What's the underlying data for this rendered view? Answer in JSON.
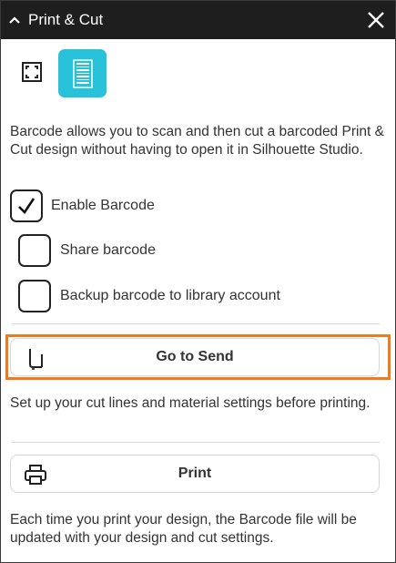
{
  "window": {
    "title": "Print & Cut",
    "collapse_icon": "chevron-up-icon",
    "close_icon": "close-icon"
  },
  "tabs": [
    {
      "icon": "crop-frame-icon",
      "active": false
    },
    {
      "icon": "barcode-icon",
      "active": true
    }
  ],
  "description": "Barcode allows you to scan and then cut a barcoded Print & Cut design without having to open it in Silhouette Studio.",
  "options": [
    {
      "label": "Enable Barcode",
      "checked": true
    },
    {
      "label": "Share barcode",
      "checked": false
    },
    {
      "label": "Backup barcode to library account",
      "checked": false
    }
  ],
  "send_button": {
    "label": "Go to Send",
    "icon": "cutter-blade-icon"
  },
  "send_hint": "Set up your cut lines and material settings before printing.",
  "print_button": {
    "label": "Print",
    "icon": "printer-icon"
  },
  "print_hint": "Each time you print your design, the Barcode file will be updated with your design and cut settings.",
  "colors": {
    "titlebar": "#1e1e1e",
    "accent": "#27c1d9",
    "highlight": "#f07b1c"
  }
}
